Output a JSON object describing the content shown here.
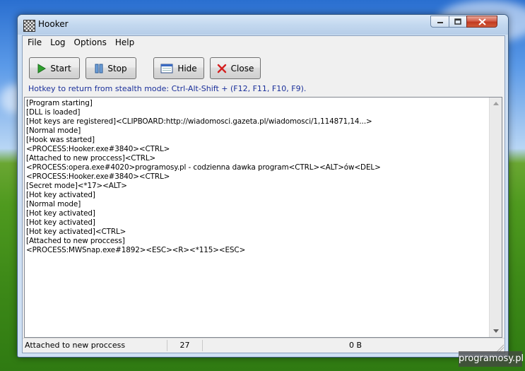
{
  "window": {
    "title": "Hooker"
  },
  "menu": {
    "items": [
      "File",
      "Log",
      "Options",
      "Help"
    ]
  },
  "toolbar": {
    "start_label": "Start",
    "stop_label": "Stop",
    "hide_label": "Hide",
    "close_label": "Close"
  },
  "hint_text": "Hotkey to return from stealth mode: Ctrl-Alt-Shift + (F12, F11, F10, F9).",
  "log": {
    "lines": [
      "[Program starting]",
      "[DLL is loaded]",
      "[Hot keys are registered]<CLIPBOARD:http://wiadomosci.gazeta.pl/wiadomosci/1,114871,14...>",
      "[Normal mode]",
      "[Hook was started]",
      "<PROCESS:Hooker.exe#3840><CTRL>",
      "[Attached to new proccess]<CTRL>",
      "<PROCESS:opera.exe#4020>programosy.pl - codzienna dawka program<CTRL><ALT>ów<DEL>",
      "<PROCESS:Hooker.exe#3840><CTRL>",
      "[Secret mode]<*17><ALT>",
      "[Hot key activated]",
      "[Normal mode]",
      "[Hot key activated]",
      "[Hot key activated]",
      "[Hot key activated]<CTRL>",
      "[Attached to new proccess]",
      "<PROCESS:MWSnap.exe#1892><ESC><R><*115><ESC>"
    ]
  },
  "status": {
    "message": "Attached to new proccess",
    "count": "27",
    "size": "0 B"
  },
  "watermark": "programosy.pl",
  "colors": {
    "hint_text": "#1a2f9a",
    "close_x": "#d42020",
    "start_play": "#2fa02f"
  }
}
